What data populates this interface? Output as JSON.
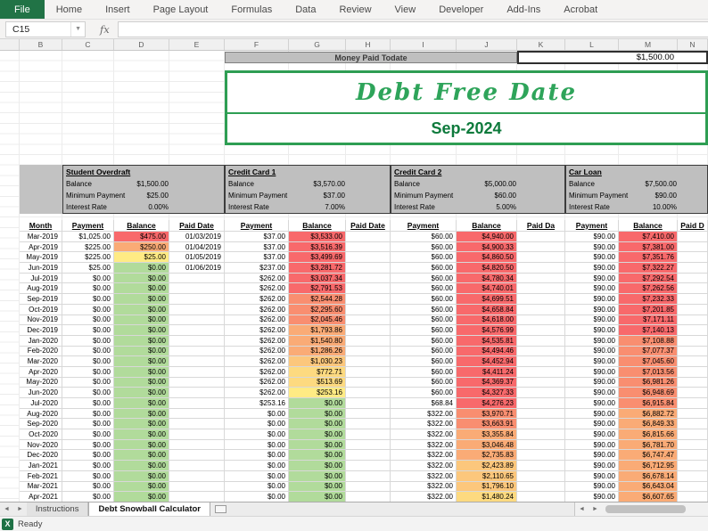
{
  "ribbon": {
    "tabs": [
      "File",
      "Home",
      "Insert",
      "Page Layout",
      "Formulas",
      "Data",
      "Review",
      "View",
      "Developer",
      "Add-Ins",
      "Acrobat"
    ]
  },
  "formula_bar": {
    "name_box": "C15",
    "fx": "fx",
    "formula": ""
  },
  "columns": {
    "letters": [
      "",
      "B",
      "C",
      "D",
      "E",
      "F",
      "G",
      "H",
      "I",
      "J",
      "K",
      "L",
      "M",
      "N"
    ]
  },
  "summary": {
    "money_paid_label": "Money Paid Todate",
    "money_paid_value": "$1,500.00",
    "debt_free_title": "Debt Free Date",
    "debt_free_date": "Sep-2024"
  },
  "debt_labels": {
    "balance": "Balance",
    "minimum_payment": "Minimum Payment",
    "interest_rate": "Interest Rate"
  },
  "debts": [
    {
      "name": "Student Overdraft",
      "balance": "$1,500.00",
      "minimum_payment": "$25.00",
      "interest_rate": "0.00%"
    },
    {
      "name": "Credit Card 1",
      "balance": "$3,570.00",
      "minimum_payment": "$37.00",
      "interest_rate": "7.00%"
    },
    {
      "name": "Credit Card 2",
      "balance": "$5,000.00",
      "minimum_payment": "$60.00",
      "interest_rate": "5.00%"
    },
    {
      "name": "Car Loan",
      "balance": "$7,500.00",
      "minimum_payment": "$90.00",
      "interest_rate": "10.00%"
    }
  ],
  "table": {
    "headers": [
      "Month",
      "Payment",
      "Balance",
      "Paid Date",
      "Payment",
      "Balance",
      "Paid Date",
      "Payment",
      "Balance",
      "Paid Da",
      "Payment",
      "Balance",
      "Paid D"
    ],
    "rows": [
      {
        "m": "Mar-2019",
        "c": [
          "$1,025.00",
          "$475.00",
          "01/03/2019",
          "$37.00",
          "$3,533.00",
          "",
          "$60.00",
          "$4,940.00",
          "",
          "$90.00",
          "$7,410.00",
          ""
        ],
        "k": [
          "red",
          "red",
          "red",
          "red"
        ]
      },
      {
        "m": "Apr-2019",
        "c": [
          "$225.00",
          "$250.00",
          "01/04/2019",
          "$37.00",
          "$3,516.39",
          "",
          "$60.00",
          "$4,900.33",
          "",
          "$90.00",
          "$7,381.00",
          ""
        ],
        "k": [
          "orange",
          "red",
          "red",
          "red"
        ]
      },
      {
        "m": "May-2019",
        "c": [
          "$225.00",
          "$25.00",
          "01/05/2019",
          "$37.00",
          "$3,499.69",
          "",
          "$60.00",
          "$4,860.50",
          "",
          "$90.00",
          "$7,351.76",
          ""
        ],
        "k": [
          "yellow",
          "red",
          "red",
          "red"
        ]
      },
      {
        "m": "Jun-2019",
        "c": [
          "$25.00",
          "$0.00",
          "01/06/2019",
          "$237.00",
          "$3,281.72",
          "",
          "$60.00",
          "$4,820.50",
          "",
          "$90.00",
          "$7,322.27",
          ""
        ],
        "k": [
          "green",
          "red",
          "red",
          "red"
        ]
      },
      {
        "m": "Jul-2019",
        "c": [
          "$0.00",
          "$0.00",
          "",
          "$262.00",
          "$3,037.34",
          "",
          "$60.00",
          "$4,780.34",
          "",
          "$90.00",
          "$7,292.54",
          ""
        ],
        "k": [
          "green",
          "red",
          "red",
          "red"
        ]
      },
      {
        "m": "Aug-2019",
        "c": [
          "$0.00",
          "$0.00",
          "",
          "$262.00",
          "$2,791.53",
          "",
          "$60.00",
          "$4,740.01",
          "",
          "$90.00",
          "$7,262.56",
          ""
        ],
        "k": [
          "green",
          "red",
          "red",
          "red"
        ]
      },
      {
        "m": "Sep-2019",
        "c": [
          "$0.00",
          "$0.00",
          "",
          "$262.00",
          "$2,544.28",
          "",
          "$60.00",
          "$4,699.51",
          "",
          "$90.00",
          "$7,232.33",
          ""
        ],
        "k": [
          "green",
          "red2",
          "red",
          "red"
        ]
      },
      {
        "m": "Oct-2019",
        "c": [
          "$0.00",
          "$0.00",
          "",
          "$262.00",
          "$2,295.60",
          "",
          "$60.00",
          "$4,658.84",
          "",
          "$90.00",
          "$7,201.85",
          ""
        ],
        "k": [
          "green",
          "red2",
          "red",
          "red"
        ]
      },
      {
        "m": "Nov-2019",
        "c": [
          "$0.00",
          "$0.00",
          "",
          "$262.00",
          "$2,045.46",
          "",
          "$60.00",
          "$4,618.00",
          "",
          "$90.00",
          "$7,171.11",
          ""
        ],
        "k": [
          "green",
          "red2",
          "red",
          "red"
        ]
      },
      {
        "m": "Dec-2019",
        "c": [
          "$0.00",
          "$0.00",
          "",
          "$262.00",
          "$1,793.86",
          "",
          "$60.00",
          "$4,576.99",
          "",
          "$90.00",
          "$7,140.13",
          ""
        ],
        "k": [
          "green",
          "orange",
          "red",
          "red"
        ]
      },
      {
        "m": "Jan-2020",
        "c": [
          "$0.00",
          "$0.00",
          "",
          "$262.00",
          "$1,540.80",
          "",
          "$60.00",
          "$4,535.81",
          "",
          "$90.00",
          "$7,108.88",
          ""
        ],
        "k": [
          "green",
          "orange",
          "red",
          "red2"
        ]
      },
      {
        "m": "Feb-2020",
        "c": [
          "$0.00",
          "$0.00",
          "",
          "$262.00",
          "$1,286.26",
          "",
          "$60.00",
          "$4,494.46",
          "",
          "$90.00",
          "$7,077.37",
          ""
        ],
        "k": [
          "green",
          "orange",
          "red",
          "red2"
        ]
      },
      {
        "m": "Mar-2020",
        "c": [
          "$0.00",
          "$0.00",
          "",
          "$262.00",
          "$1,030.23",
          "",
          "$60.00",
          "$4,452.94",
          "",
          "$90.00",
          "$7,045.60",
          ""
        ],
        "k": [
          "green",
          "lorange",
          "red",
          "red2"
        ]
      },
      {
        "m": "Apr-2020",
        "c": [
          "$0.00",
          "$0.00",
          "",
          "$262.00",
          "$772.71",
          "",
          "$60.00",
          "$4,411.24",
          "",
          "$90.00",
          "$7,013.56",
          ""
        ],
        "k": [
          "green",
          "peach",
          "red",
          "red2"
        ]
      },
      {
        "m": "May-2020",
        "c": [
          "$0.00",
          "$0.00",
          "",
          "$262.00",
          "$513.69",
          "",
          "$60.00",
          "$4,369.37",
          "",
          "$90.00",
          "$6,981.26",
          ""
        ],
        "k": [
          "green",
          "peach",
          "red",
          "red2"
        ]
      },
      {
        "m": "Jun-2020",
        "c": [
          "$0.00",
          "$0.00",
          "",
          "$262.00",
          "$253.16",
          "",
          "$60.00",
          "$4,327.33",
          "",
          "$90.00",
          "$6,948.69",
          ""
        ],
        "k": [
          "green",
          "yellow",
          "red",
          "red2"
        ]
      },
      {
        "m": "Jul-2020",
        "c": [
          "$0.00",
          "$0.00",
          "",
          "$253.16",
          "$0.00",
          "",
          "$68.84",
          "$4,276.23",
          "",
          "$90.00",
          "$6,915.84",
          ""
        ],
        "k": [
          "green",
          "green",
          "red",
          "red2"
        ]
      },
      {
        "m": "Aug-2020",
        "c": [
          "$0.00",
          "$0.00",
          "",
          "$0.00",
          "$0.00",
          "",
          "$322.00",
          "$3,970.71",
          "",
          "$90.00",
          "$6,882.72",
          ""
        ],
        "k": [
          "green",
          "green",
          "red2",
          "orange"
        ]
      },
      {
        "m": "Sep-2020",
        "c": [
          "$0.00",
          "$0.00",
          "",
          "$0.00",
          "$0.00",
          "",
          "$322.00",
          "$3,663.91",
          "",
          "$90.00",
          "$6,849.33",
          ""
        ],
        "k": [
          "green",
          "green",
          "red2",
          "orange"
        ]
      },
      {
        "m": "Oct-2020",
        "c": [
          "$0.00",
          "$0.00",
          "",
          "$0.00",
          "$0.00",
          "",
          "$322.00",
          "$3,355.84",
          "",
          "$90.00",
          "$6,815.66",
          ""
        ],
        "k": [
          "green",
          "green",
          "orange",
          "orange"
        ]
      },
      {
        "m": "Nov-2020",
        "c": [
          "$0.00",
          "$0.00",
          "",
          "$0.00",
          "$0.00",
          "",
          "$322.00",
          "$3,046.48",
          "",
          "$90.00",
          "$6,781.70",
          ""
        ],
        "k": [
          "green",
          "green",
          "orange",
          "orange"
        ]
      },
      {
        "m": "Dec-2020",
        "c": [
          "$0.00",
          "$0.00",
          "",
          "$0.00",
          "$0.00",
          "",
          "$322.00",
          "$2,735.83",
          "",
          "$90.00",
          "$6,747.47",
          ""
        ],
        "k": [
          "green",
          "green",
          "orange",
          "orange"
        ]
      },
      {
        "m": "Jan-2021",
        "c": [
          "$0.00",
          "$0.00",
          "",
          "$0.00",
          "$0.00",
          "",
          "$322.00",
          "$2,423.89",
          "",
          "$90.00",
          "$6,712.95",
          ""
        ],
        "k": [
          "green",
          "green",
          "lorange",
          "orange"
        ]
      },
      {
        "m": "Feb-2021",
        "c": [
          "$0.00",
          "$0.00",
          "",
          "$0.00",
          "$0.00",
          "",
          "$322.00",
          "$2,110.65",
          "",
          "$90.00",
          "$6,678.14",
          ""
        ],
        "k": [
          "green",
          "green",
          "lorange",
          "orange"
        ]
      },
      {
        "m": "Mar-2021",
        "c": [
          "$0.00",
          "$0.00",
          "",
          "$0.00",
          "$0.00",
          "",
          "$322.00",
          "$1,796.10",
          "",
          "$90.00",
          "$6,643.04",
          ""
        ],
        "k": [
          "green",
          "green",
          "lorange",
          "orange"
        ]
      },
      {
        "m": "Apr-2021",
        "c": [
          "$0.00",
          "$0.00",
          "",
          "$0.00",
          "$0.00",
          "",
          "$322.00",
          "$1,480.24",
          "",
          "$90.00",
          "$6,607.65",
          ""
        ],
        "k": [
          "green",
          "green",
          "peach",
          "orange"
        ]
      }
    ]
  },
  "palette": {
    "red": "#F8696B",
    "red2": "#F98E70",
    "orange": "#FAAB76",
    "lorange": "#FCC77C",
    "peach": "#FDDA80",
    "yellow": "#FFEB84",
    "green": "#B1DB9B",
    "file_tab_green": "#217346",
    "debt_free_border_green": "#2E9E53",
    "debt_free_text_green": "#2EA45A",
    "header_gray": "#BFBFBF"
  },
  "sheet_tabs": {
    "tabs": [
      "Instructions",
      "Debt Snowball Calculator"
    ],
    "active": "Debt Snowball Calculator"
  },
  "status": {
    "mode": "Ready"
  }
}
